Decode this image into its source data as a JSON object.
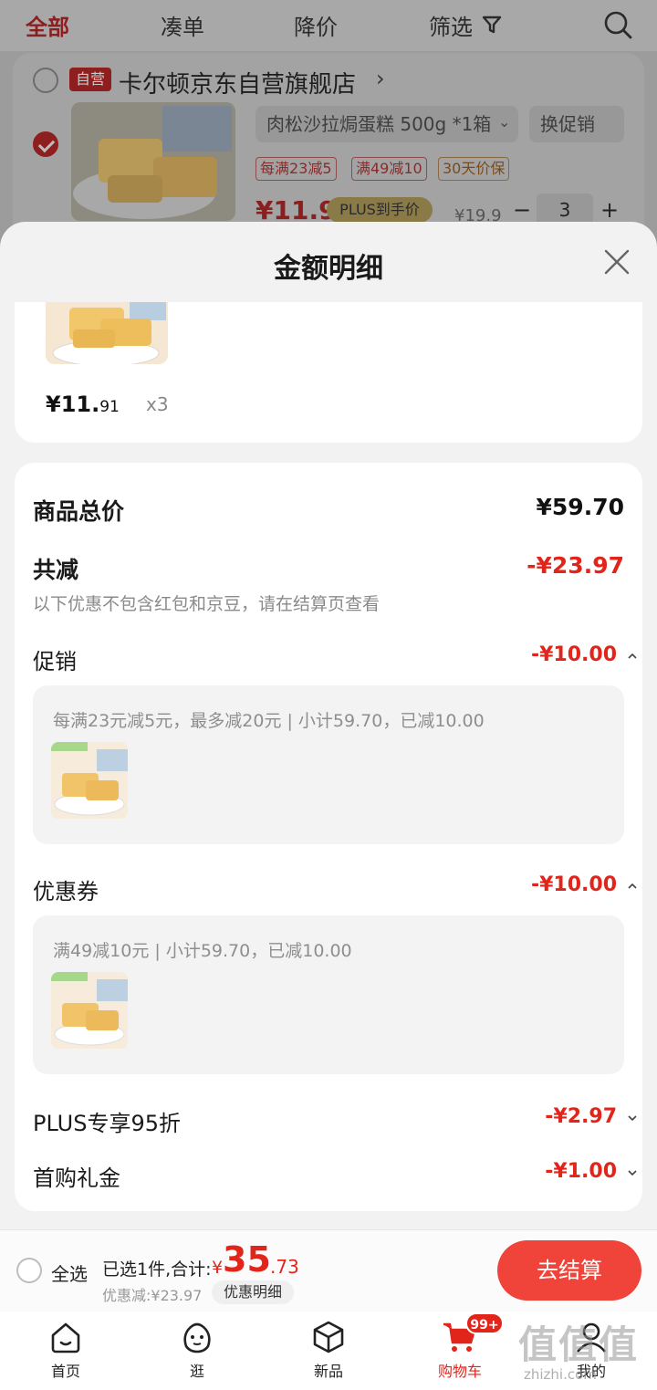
{
  "top_nav": {
    "tabs": [
      "全部",
      "凑单",
      "降价",
      "筛选"
    ]
  },
  "shop": {
    "badge": "自营",
    "name": "卡尔顿京东自营旗舰店",
    "product": {
      "sku": "肉松沙拉焗蛋糕 500g *1箱",
      "promo_switch": "换促销",
      "tags": [
        "每满23减5",
        "满49减10",
        "30天价保"
      ],
      "price": "¥11.91",
      "plus_label": "PLUS到手价",
      "original_price": "¥19.9",
      "quantity": "3"
    }
  },
  "sheet": {
    "title": "金额明细",
    "item_price_int": "¥11.",
    "item_price_dec": "91",
    "item_qty": "x3",
    "total_label": "商品总价",
    "total_value": "¥59.70",
    "reduce_label": "共减",
    "reduce_value": "-¥23.97",
    "reduce_note": "以下优惠不包含红包和京豆，请在结算页查看",
    "promo": {
      "label": "促销",
      "value": "-¥10.00",
      "desc": "每满23元减5元，最多减20元 | 小计59.70，已减10.00"
    },
    "coupon": {
      "label": "优惠券",
      "value": "-¥10.00",
      "desc": "满49减10元 | 小计59.70，已减10.00"
    },
    "plus": {
      "label": "PLUS专享95折",
      "value": "-¥2.97"
    },
    "gift": {
      "label": "首购礼金",
      "value": "-¥1.00"
    }
  },
  "action_bar": {
    "select_all": "全选",
    "selected": "已选1件,合计:",
    "total_yen": "¥",
    "total_int": "35",
    "total_dec": ".73",
    "discount": "优惠减:¥23.97",
    "detail_button": "优惠明细",
    "checkout_button": "去结算"
  },
  "tab_bar": {
    "items": [
      "首页",
      "逛",
      "新品",
      "购物车",
      "我的"
    ],
    "cart_badge": "99+"
  },
  "watermark": {
    "logo": "值值值",
    "url": "zhizhi.com"
  },
  "colors": {
    "accent": "#e1251b",
    "checkout": "#f0443a"
  }
}
